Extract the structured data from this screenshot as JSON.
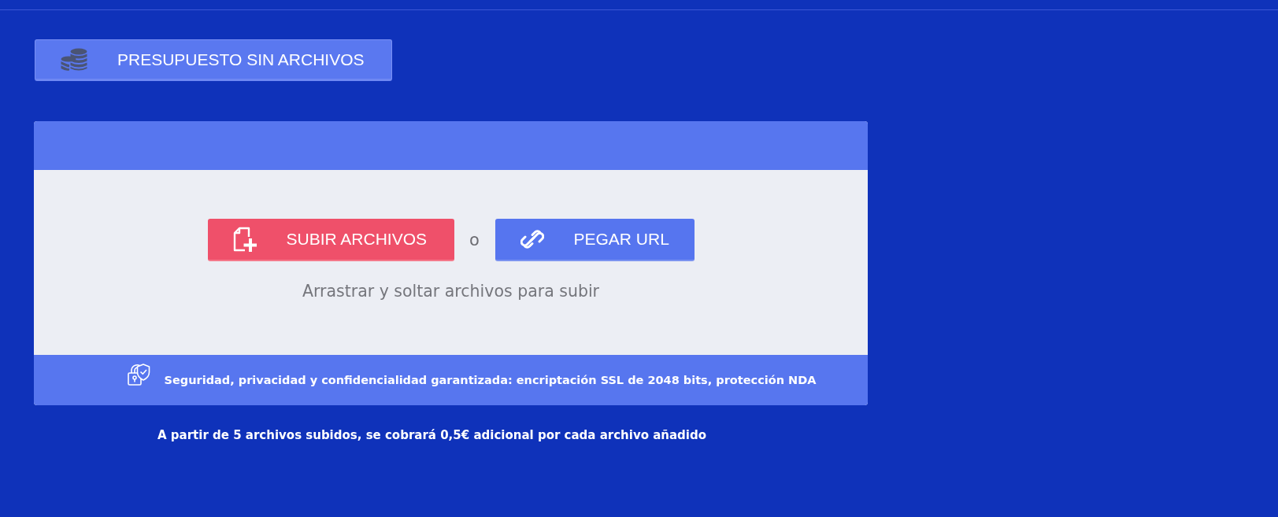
{
  "top_button": {
    "label": "PRESUPUESTO SIN ARCHIVOS"
  },
  "upload_panel": {
    "buttons": [
      {
        "kind": "upload",
        "label": "SUBIR ARCHIVOS"
      },
      {
        "kind": "url",
        "label": "PEGAR URL"
      }
    ],
    "separator": "o",
    "hint": "Arrastrar y soltar archivos para subir",
    "security_note": "Seguridad, privacidad y confidencialidad garantizada: encriptación SSL de 2048 bits, protección NDA"
  },
  "footer_note": "A partir de 5 archivos subidos, se cobrará 0,5€ adicional por cada archivo añadido"
}
